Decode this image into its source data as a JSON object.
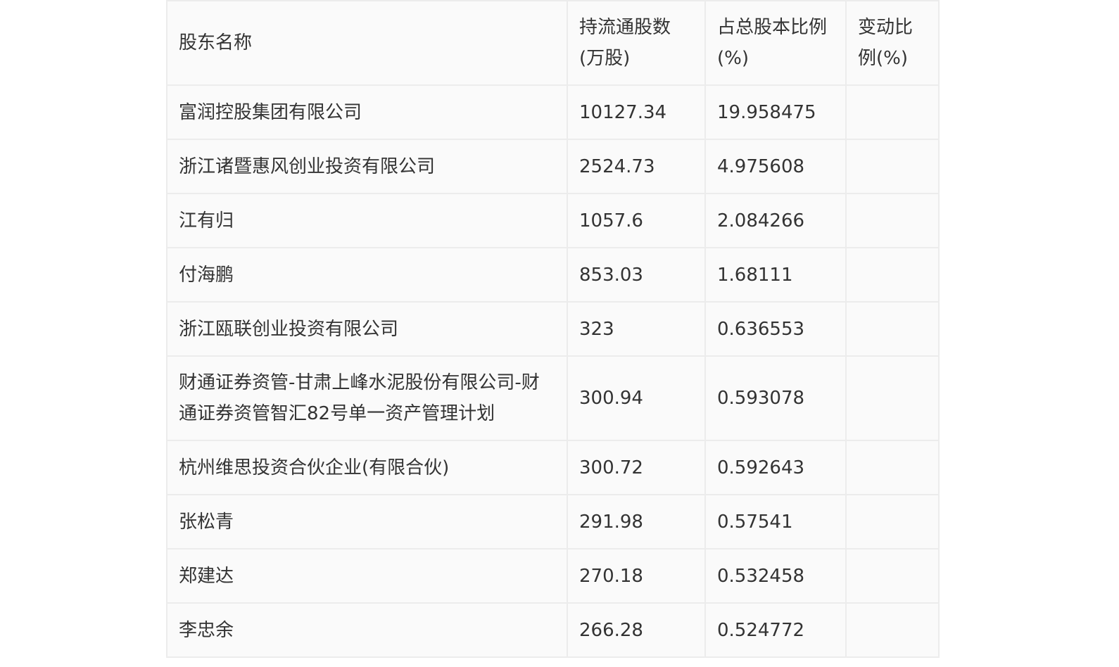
{
  "table": {
    "headers": [
      "股东名称",
      "持流通股数(万股)",
      "占总股本比例(%)",
      "变动比例(%)"
    ],
    "rows": [
      {
        "name": "富润控股集团有限公司",
        "shares": "10127.34",
        "ratio": "19.958475",
        "change": ""
      },
      {
        "name": "浙江诸暨惠风创业投资有限公司",
        "shares": "2524.73",
        "ratio": "4.975608",
        "change": ""
      },
      {
        "name": "江有归",
        "shares": "1057.6",
        "ratio": "2.084266",
        "change": ""
      },
      {
        "name": "付海鹏",
        "shares": "853.03",
        "ratio": "1.68111",
        "change": ""
      },
      {
        "name": "浙江瓯联创业投资有限公司",
        "shares": "323",
        "ratio": "0.636553",
        "change": ""
      },
      {
        "name": "财通证券资管-甘肃上峰水泥股份有限公司-财通证券资管智汇82号单一资产管理计划",
        "shares": "300.94",
        "ratio": "0.593078",
        "change": ""
      },
      {
        "name": "杭州维思投资合伙企业(有限合伙)",
        "shares": "300.72",
        "ratio": "0.592643",
        "change": ""
      },
      {
        "name": "张松青",
        "shares": "291.98",
        "ratio": "0.57541",
        "change": ""
      },
      {
        "name": "郑建达",
        "shares": "270.18",
        "ratio": "0.532458",
        "change": ""
      },
      {
        "name": "李忠余",
        "shares": "266.28",
        "ratio": "0.524772",
        "change": ""
      }
    ]
  }
}
